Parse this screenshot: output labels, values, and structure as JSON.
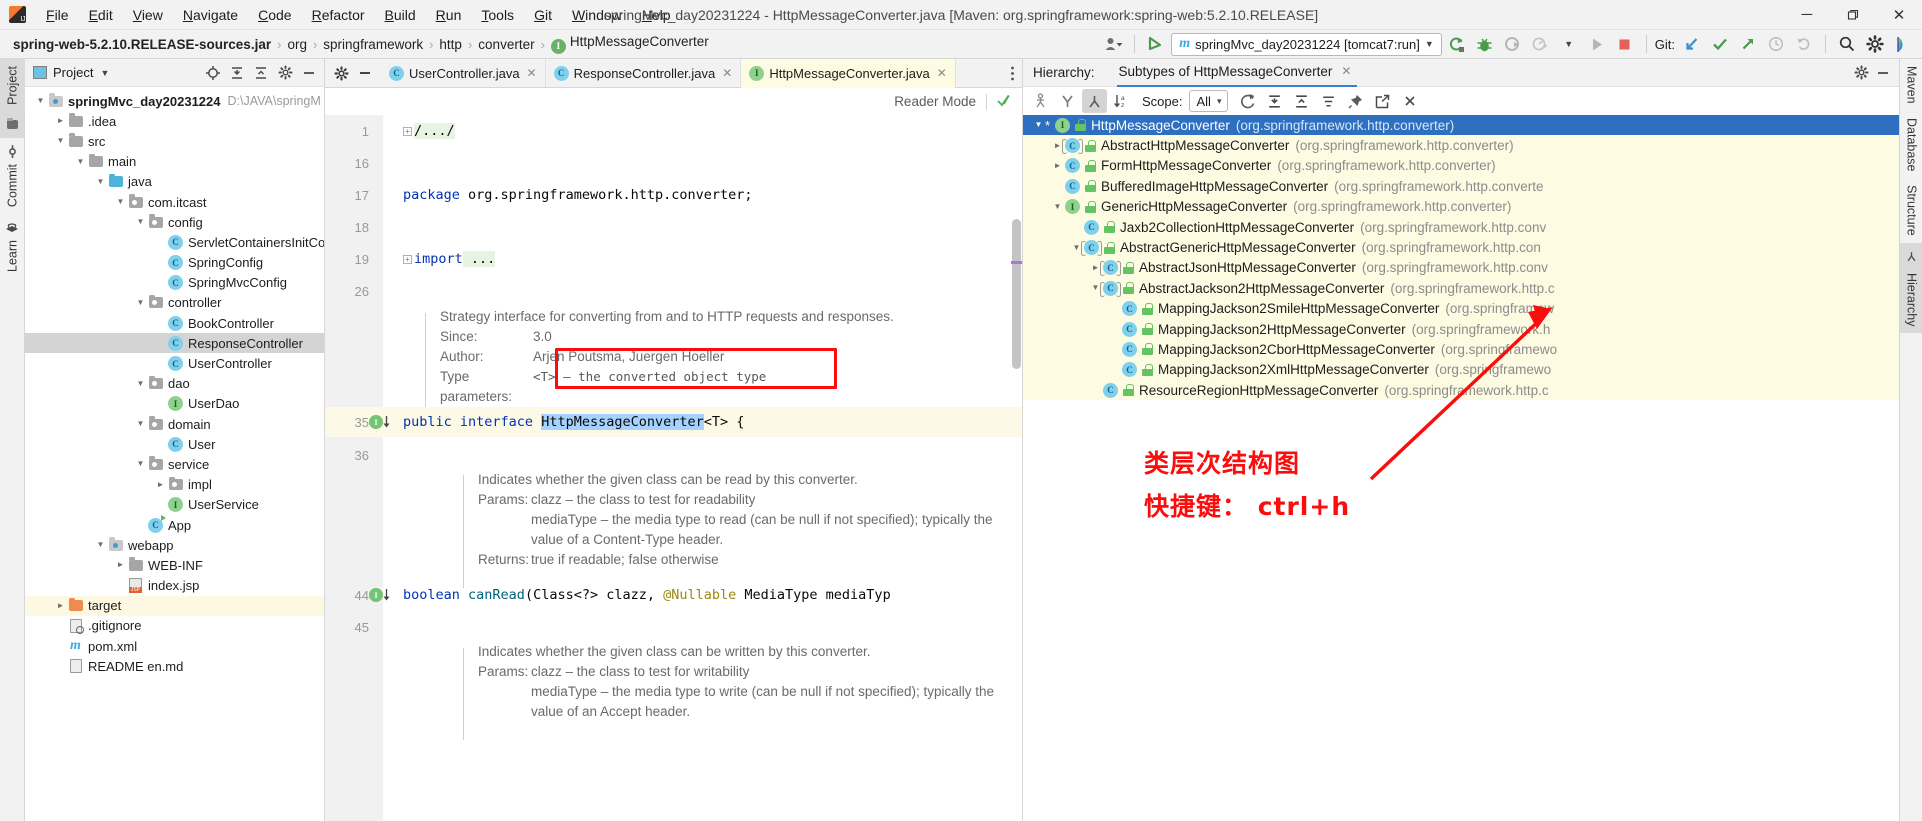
{
  "window": {
    "title": "springMvc_day20231224 - HttpMessageConverter.java [Maven: org.springframework:spring-web:5.2.10.RELEASE]",
    "minimize": "─",
    "maximize": "❐",
    "close": "✕"
  },
  "menubar": {
    "items": [
      "File",
      "Edit",
      "View",
      "Navigate",
      "Code",
      "Refactor",
      "Build",
      "Run",
      "Tools",
      "Git",
      "Window",
      "Help"
    ]
  },
  "navbar": {
    "crumbs": [
      {
        "label": "spring-web-5.2.10.RELEASE-sources.jar",
        "bold": true,
        "icon": ""
      },
      {
        "label": "org",
        "bold": false,
        "icon": ""
      },
      {
        "label": "springframework",
        "bold": false,
        "icon": ""
      },
      {
        "label": "http",
        "bold": false,
        "icon": ""
      },
      {
        "label": "converter",
        "bold": false,
        "icon": ""
      },
      {
        "label": "HttpMessageConverter",
        "bold": false,
        "icon": "interface-icon"
      }
    ],
    "separator": "›",
    "run_config": "springMvc_day20231224 [tomcat7:run]",
    "git_label": "Git:"
  },
  "left_tool_strip": {
    "items": [
      "Project",
      "Commit",
      "Learn"
    ]
  },
  "right_tool_strip": {
    "items": [
      "Maven",
      "Database",
      "Structure",
      "Hierarchy"
    ]
  },
  "project_panel": {
    "title": "Project",
    "tree": [
      {
        "depth": 0,
        "label": "springMvc_day20231224",
        "path": "D:\\JAVA\\springM",
        "icon": "module-folder-icon",
        "twist": "⌄",
        "bold": true
      },
      {
        "depth": 1,
        "label": ".idea",
        "icon": "folder-icon",
        "twist": "›"
      },
      {
        "depth": 1,
        "label": "src",
        "icon": "folder-icon",
        "twist": "⌄"
      },
      {
        "depth": 2,
        "label": "main",
        "icon": "folder-icon",
        "twist": "⌄"
      },
      {
        "depth": 3,
        "label": "java",
        "icon": "source-folder-icon",
        "twist": "⌄"
      },
      {
        "depth": 4,
        "label": "com.itcast",
        "icon": "package-icon",
        "twist": "⌄"
      },
      {
        "depth": 5,
        "label": "config",
        "icon": "package-icon",
        "twist": "⌄"
      },
      {
        "depth": 6,
        "label": "ServletContainersInitCon",
        "icon": "class-icon",
        "twist": ""
      },
      {
        "depth": 6,
        "label": "SpringConfig",
        "icon": "class-icon",
        "twist": ""
      },
      {
        "depth": 6,
        "label": "SpringMvcConfig",
        "icon": "class-icon",
        "twist": ""
      },
      {
        "depth": 5,
        "label": "controller",
        "icon": "package-icon",
        "twist": "⌄"
      },
      {
        "depth": 6,
        "label": "BookController",
        "icon": "class-icon",
        "twist": ""
      },
      {
        "depth": 6,
        "label": "ResponseController",
        "icon": "class-icon",
        "twist": "",
        "selected": true
      },
      {
        "depth": 6,
        "label": "UserController",
        "icon": "class-icon",
        "twist": ""
      },
      {
        "depth": 5,
        "label": "dao",
        "icon": "package-icon",
        "twist": "⌄"
      },
      {
        "depth": 6,
        "label": "UserDao",
        "icon": "interface-icon",
        "twist": ""
      },
      {
        "depth": 5,
        "label": "domain",
        "icon": "package-icon",
        "twist": "⌄"
      },
      {
        "depth": 6,
        "label": "User",
        "icon": "class-icon",
        "twist": ""
      },
      {
        "depth": 5,
        "label": "service",
        "icon": "package-icon",
        "twist": "⌄"
      },
      {
        "depth": 6,
        "label": "impl",
        "icon": "package-icon",
        "twist": "›"
      },
      {
        "depth": 6,
        "label": "UserService",
        "icon": "interface-icon",
        "twist": ""
      },
      {
        "depth": 5,
        "label": "App",
        "icon": "runnable-class-icon",
        "twist": ""
      },
      {
        "depth": 3,
        "label": "webapp",
        "icon": "webapp-folder-icon",
        "twist": "⌄"
      },
      {
        "depth": 4,
        "label": "WEB-INF",
        "icon": "folder-icon",
        "twist": "›"
      },
      {
        "depth": 4,
        "label": "index.jsp",
        "icon": "jsp-file-icon",
        "twist": ""
      },
      {
        "depth": 1,
        "label": "target",
        "icon": "target-folder-icon",
        "twist": "›",
        "highlight": true
      },
      {
        "depth": 1,
        "label": ".gitignore",
        "icon": "gitignore-file-icon",
        "twist": ""
      },
      {
        "depth": 1,
        "label": "pom.xml",
        "icon": "maven-file-icon",
        "twist": ""
      },
      {
        "depth": 1,
        "label": "README en.md",
        "icon": "markdown-file-icon",
        "twist": ""
      }
    ]
  },
  "editor": {
    "tabs": [
      {
        "label": "UserController.java",
        "icon": "class-icon",
        "active": false
      },
      {
        "label": "ResponseController.java",
        "icon": "class-icon",
        "active": false
      },
      {
        "label": "HttpMessageConverter.java",
        "icon": "interface-icon",
        "active": true
      }
    ],
    "close_glyph": "✕",
    "reader_mode": "Reader Mode",
    "lines": [
      {
        "num": "1",
        "fold": "+",
        "text": "/.../",
        "style": "fold-comment"
      },
      {
        "num": "16",
        "text": ""
      },
      {
        "num": "17",
        "kw": "package",
        "rest": " org.springframework.http.converter;"
      },
      {
        "num": "18",
        "text": ""
      },
      {
        "num": "19",
        "fold": "+",
        "kw": "import",
        "rest": " ..."
      },
      {
        "num": "26",
        "text": ""
      },
      {
        "num": "35",
        "kw": "public interface",
        "rest": "HttpMessageConverter<T> {",
        "highlighted": true,
        "gutter_icon": "implemented-interface-icon"
      },
      {
        "num": "36",
        "text": ""
      },
      {
        "num": "44",
        "kw": "boolean",
        "rest": " canRead(Class<?> clazz, @Nullable MediaType mediaTyp",
        "gutter_icon": "implemented-method-icon"
      },
      {
        "num": "45",
        "text": ""
      }
    ],
    "doc_blocks": [
      {
        "id": "class-doc",
        "lines": [
          {
            "text": "Strategy interface for converting from and to HTTP requests and responses."
          },
          {
            "label": "Since:",
            "value": "3.0"
          },
          {
            "label": "Author:",
            "value": "Arjen Poutsma, Juergen Hoeller"
          },
          {
            "label": "Type parameters:",
            "value": "<T> – the converted object type"
          }
        ]
      },
      {
        "id": "canread-doc",
        "lines": [
          {
            "text": "Indicates whether the given class can be read by this converter."
          },
          {
            "label": "Params:",
            "value": "clazz – the class to test for readability"
          },
          {
            "text": "mediaType – the media type to read (can be null if not specified); typically the"
          },
          {
            "text": "value of a Content-Type header."
          },
          {
            "label": "Returns:",
            "value": "true if readable; false otherwise"
          }
        ]
      },
      {
        "id": "canwrite-doc",
        "lines": [
          {
            "text": "Indicates whether the given class can be written by this converter."
          },
          {
            "label": "Params:",
            "value": "clazz – the class to test for writability"
          },
          {
            "text": "mediaType – the media type to write (can be null if not specified); typically the"
          },
          {
            "text": "value of an Accept header."
          }
        ]
      }
    ],
    "selected_token": "HttpMessageConverter"
  },
  "hierarchy": {
    "label": "Hierarchy:",
    "tab": "Subtypes of HttpMessageConverter",
    "tab_close": "✕",
    "scope_label": "Scope:",
    "scope_value": "All",
    "scope_caret": "▾",
    "tree": [
      {
        "depth": 0,
        "twist": "⌄",
        "star": "*",
        "icon": "interface-icon",
        "name": "HttpMessageConverter",
        "pkg": "(org.springframework.http.converter)",
        "selected": true
      },
      {
        "depth": 1,
        "twist": "›",
        "icon": "abstract-class-icon",
        "name": "AbstractHttpMessageConverter",
        "pkg": "(org.springframework.http.converter)"
      },
      {
        "depth": 1,
        "twist": "›",
        "icon": "class-icon",
        "name": "FormHttpMessageConverter",
        "pkg": "(org.springframework.http.converter)"
      },
      {
        "depth": 1,
        "twist": "",
        "icon": "class-icon",
        "name": "BufferedImageHttpMessageConverter",
        "pkg": "(org.springframework.http.converte"
      },
      {
        "depth": 1,
        "twist": "⌄",
        "icon": "interface-icon",
        "name": "GenericHttpMessageConverter",
        "pkg": "(org.springframework.http.converter)"
      },
      {
        "depth": 2,
        "twist": "",
        "icon": "class-icon",
        "name": "Jaxb2CollectionHttpMessageConverter",
        "pkg": "(org.springframework.http.conv"
      },
      {
        "depth": 2,
        "twist": "⌄",
        "icon": "abstract-class-icon",
        "name": "AbstractGenericHttpMessageConverter",
        "pkg": "(org.springframework.http.con"
      },
      {
        "depth": 3,
        "twist": "›",
        "icon": "abstract-class-icon",
        "name": "AbstractJsonHttpMessageConverter",
        "pkg": "(org.springframework.http.conv"
      },
      {
        "depth": 3,
        "twist": "⌄",
        "icon": "abstract-class-icon",
        "name": "AbstractJackson2HttpMessageConverter",
        "pkg": "(org.springframework.http.c"
      },
      {
        "depth": 4,
        "twist": "",
        "icon": "class-icon",
        "name": "MappingJackson2SmileHttpMessageConverter",
        "pkg": "(org.springframew"
      },
      {
        "depth": 4,
        "twist": "",
        "icon": "class-icon",
        "name": "MappingJackson2HttpMessageConverter",
        "pkg": "(org.springframework.h"
      },
      {
        "depth": 4,
        "twist": "",
        "icon": "class-icon",
        "name": "MappingJackson2CborHttpMessageConverter",
        "pkg": "(org.springframewo"
      },
      {
        "depth": 4,
        "twist": "",
        "icon": "class-icon",
        "name": "MappingJackson2XmlHttpMessageConverter",
        "pkg": "(org.springframewo"
      },
      {
        "depth": 3,
        "twist": "",
        "icon": "class-icon",
        "name": "ResourceRegionHttpMessageConverter",
        "pkg": "(org.springframework.http.c"
      }
    ]
  },
  "annotations": {
    "line1": "类层次结构图",
    "line2": "快捷键： ctrl+h",
    "color": "#fb0d0d"
  }
}
